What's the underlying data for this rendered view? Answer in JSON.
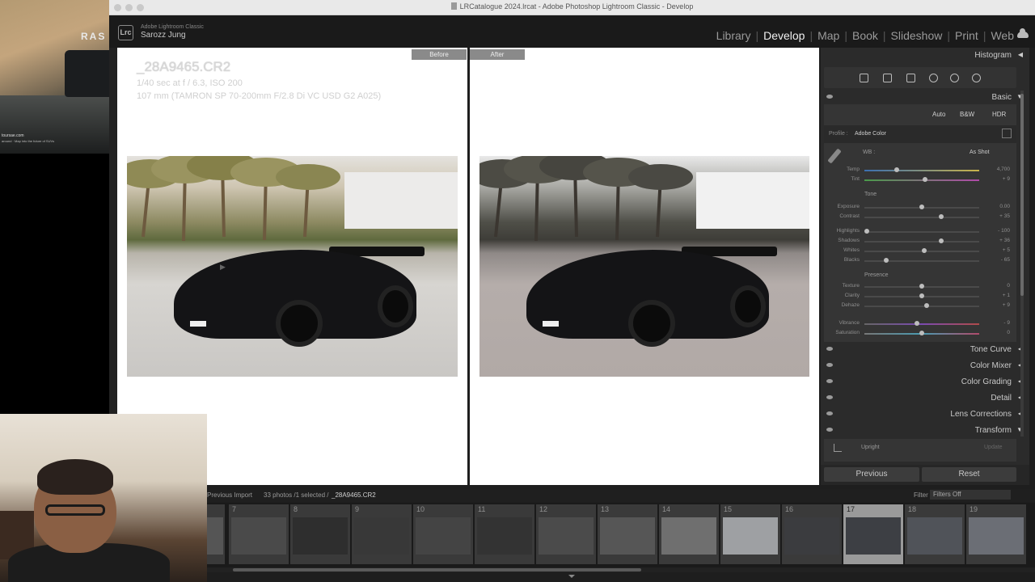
{
  "overlay": {
    "brand": "RAS",
    "url": "toursae.com",
    "sub": "around · Map into the future of SUVs"
  },
  "window_title": "LRCatalogue 2024.lrcat - Adobe Photoshop Lightroom Classic - Develop",
  "app": {
    "logo": "Lrc",
    "name": "Adobe Lightroom Classic",
    "user": "Sarozz Jung"
  },
  "modules": [
    "Library",
    "Develop",
    "Map",
    "Book",
    "Slideshow",
    "Print",
    "Web"
  ],
  "active_module": "Develop",
  "view": {
    "before_label": "Before",
    "after_label": "After",
    "filename": "_28A9465.CR2",
    "exposure": "1/40 sec at f / 6.3, ISO 200",
    "lens": "107 mm (TAMRON SP 70-200mm F/2.8 Di VC USD G2 A025)"
  },
  "panel": {
    "histogram": "Histogram",
    "basic": "Basic",
    "auto": "Auto",
    "bw": "B&W",
    "hdr": "HDR",
    "profile_label": "Profile :",
    "profile_value": "Adobe Color",
    "wb_label": "WB :",
    "wb_value": "As Shot",
    "tone_label": "Tone",
    "presence_label": "Presence",
    "sliders": [
      {
        "name": "Temp",
        "value": "4,700",
        "pos": 0.28
      },
      {
        "name": "Tint",
        "value": "+ 9",
        "pos": 0.53
      },
      {
        "name": "Exposure",
        "value": "0.00",
        "pos": 0.5
      },
      {
        "name": "Contrast",
        "value": "+ 35",
        "pos": 0.67
      },
      {
        "name": "Highlights",
        "value": "- 100",
        "pos": 0.02
      },
      {
        "name": "Shadows",
        "value": "+ 36",
        "pos": 0.67
      },
      {
        "name": "Whites",
        "value": "+ 5",
        "pos": 0.52
      },
      {
        "name": "Blacks",
        "value": "- 65",
        "pos": 0.19
      },
      {
        "name": "Texture",
        "value": "0",
        "pos": 0.5
      },
      {
        "name": "Clarity",
        "value": "+ 1",
        "pos": 0.5
      },
      {
        "name": "Dehaze",
        "value": "+ 9",
        "pos": 0.54
      },
      {
        "name": "Vibrance",
        "value": "- 9",
        "pos": 0.46
      },
      {
        "name": "Saturation",
        "value": "0",
        "pos": 0.5
      }
    ],
    "sections": [
      "Tone Curve",
      "Color Mixer",
      "Color Grading",
      "Detail",
      "Lens Corrections",
      "Transform"
    ],
    "upright": "Upright",
    "update": "Update",
    "previous": "Previous",
    "reset": "Reset"
  },
  "filmstrip": {
    "source": "Previous Import",
    "count": "33 photos /1 selected /",
    "filename": "_28A9465.CR2",
    "filter_label": "Filter :",
    "filter_value": "Filters Off",
    "frames": [
      "7",
      "8",
      "9",
      "10",
      "11",
      "12",
      "13",
      "14",
      "15",
      "16",
      "17",
      "18",
      "19"
    ],
    "selected": "17"
  },
  "colors": {
    "accent": "#f0f0f0",
    "panel": "#353535",
    "selected_cell": "#9a9a9a"
  }
}
